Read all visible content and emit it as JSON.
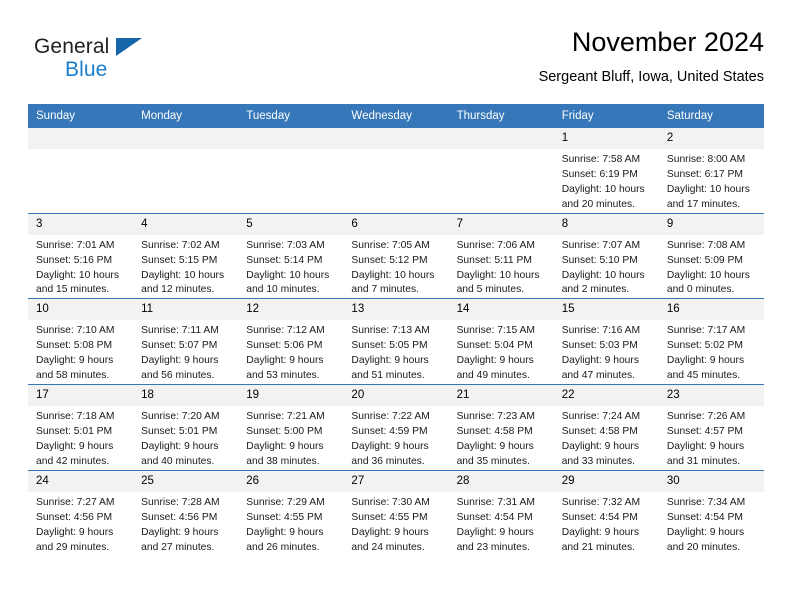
{
  "brand": {
    "name_part1": "General",
    "name_part2": "Blue"
  },
  "header": {
    "title": "November 2024",
    "location": "Sergeant Bluff, Iowa, United States"
  },
  "colors": {
    "header_blue": "#3577b8",
    "brand_blue": "#1b7fd0",
    "daynum_bg": "#f2f2f2"
  },
  "weekdays": [
    "Sunday",
    "Monday",
    "Tuesday",
    "Wednesday",
    "Thursday",
    "Friday",
    "Saturday"
  ],
  "weeks": [
    [
      {
        "day": "",
        "empty": true
      },
      {
        "day": "",
        "empty": true
      },
      {
        "day": "",
        "empty": true
      },
      {
        "day": "",
        "empty": true
      },
      {
        "day": "",
        "empty": true
      },
      {
        "day": "1",
        "sunrise": "Sunrise: 7:58 AM",
        "sunset": "Sunset: 6:19 PM",
        "daylight1": "Daylight: 10 hours",
        "daylight2": "and 20 minutes."
      },
      {
        "day": "2",
        "sunrise": "Sunrise: 8:00 AM",
        "sunset": "Sunset: 6:17 PM",
        "daylight1": "Daylight: 10 hours",
        "daylight2": "and 17 minutes."
      }
    ],
    [
      {
        "day": "3",
        "sunrise": "Sunrise: 7:01 AM",
        "sunset": "Sunset: 5:16 PM",
        "daylight1": "Daylight: 10 hours",
        "daylight2": "and 15 minutes."
      },
      {
        "day": "4",
        "sunrise": "Sunrise: 7:02 AM",
        "sunset": "Sunset: 5:15 PM",
        "daylight1": "Daylight: 10 hours",
        "daylight2": "and 12 minutes."
      },
      {
        "day": "5",
        "sunrise": "Sunrise: 7:03 AM",
        "sunset": "Sunset: 5:14 PM",
        "daylight1": "Daylight: 10 hours",
        "daylight2": "and 10 minutes."
      },
      {
        "day": "6",
        "sunrise": "Sunrise: 7:05 AM",
        "sunset": "Sunset: 5:12 PM",
        "daylight1": "Daylight: 10 hours",
        "daylight2": "and 7 minutes."
      },
      {
        "day": "7",
        "sunrise": "Sunrise: 7:06 AM",
        "sunset": "Sunset: 5:11 PM",
        "daylight1": "Daylight: 10 hours",
        "daylight2": "and 5 minutes."
      },
      {
        "day": "8",
        "sunrise": "Sunrise: 7:07 AM",
        "sunset": "Sunset: 5:10 PM",
        "daylight1": "Daylight: 10 hours",
        "daylight2": "and 2 minutes."
      },
      {
        "day": "9",
        "sunrise": "Sunrise: 7:08 AM",
        "sunset": "Sunset: 5:09 PM",
        "daylight1": "Daylight: 10 hours",
        "daylight2": "and 0 minutes."
      }
    ],
    [
      {
        "day": "10",
        "sunrise": "Sunrise: 7:10 AM",
        "sunset": "Sunset: 5:08 PM",
        "daylight1": "Daylight: 9 hours",
        "daylight2": "and 58 minutes."
      },
      {
        "day": "11",
        "sunrise": "Sunrise: 7:11 AM",
        "sunset": "Sunset: 5:07 PM",
        "daylight1": "Daylight: 9 hours",
        "daylight2": "and 56 minutes."
      },
      {
        "day": "12",
        "sunrise": "Sunrise: 7:12 AM",
        "sunset": "Sunset: 5:06 PM",
        "daylight1": "Daylight: 9 hours",
        "daylight2": "and 53 minutes."
      },
      {
        "day": "13",
        "sunrise": "Sunrise: 7:13 AM",
        "sunset": "Sunset: 5:05 PM",
        "daylight1": "Daylight: 9 hours",
        "daylight2": "and 51 minutes."
      },
      {
        "day": "14",
        "sunrise": "Sunrise: 7:15 AM",
        "sunset": "Sunset: 5:04 PM",
        "daylight1": "Daylight: 9 hours",
        "daylight2": "and 49 minutes."
      },
      {
        "day": "15",
        "sunrise": "Sunrise: 7:16 AM",
        "sunset": "Sunset: 5:03 PM",
        "daylight1": "Daylight: 9 hours",
        "daylight2": "and 47 minutes."
      },
      {
        "day": "16",
        "sunrise": "Sunrise: 7:17 AM",
        "sunset": "Sunset: 5:02 PM",
        "daylight1": "Daylight: 9 hours",
        "daylight2": "and 45 minutes."
      }
    ],
    [
      {
        "day": "17",
        "sunrise": "Sunrise: 7:18 AM",
        "sunset": "Sunset: 5:01 PM",
        "daylight1": "Daylight: 9 hours",
        "daylight2": "and 42 minutes."
      },
      {
        "day": "18",
        "sunrise": "Sunrise: 7:20 AM",
        "sunset": "Sunset: 5:01 PM",
        "daylight1": "Daylight: 9 hours",
        "daylight2": "and 40 minutes."
      },
      {
        "day": "19",
        "sunrise": "Sunrise: 7:21 AM",
        "sunset": "Sunset: 5:00 PM",
        "daylight1": "Daylight: 9 hours",
        "daylight2": "and 38 minutes."
      },
      {
        "day": "20",
        "sunrise": "Sunrise: 7:22 AM",
        "sunset": "Sunset: 4:59 PM",
        "daylight1": "Daylight: 9 hours",
        "daylight2": "and 36 minutes."
      },
      {
        "day": "21",
        "sunrise": "Sunrise: 7:23 AM",
        "sunset": "Sunset: 4:58 PM",
        "daylight1": "Daylight: 9 hours",
        "daylight2": "and 35 minutes."
      },
      {
        "day": "22",
        "sunrise": "Sunrise: 7:24 AM",
        "sunset": "Sunset: 4:58 PM",
        "daylight1": "Daylight: 9 hours",
        "daylight2": "and 33 minutes."
      },
      {
        "day": "23",
        "sunrise": "Sunrise: 7:26 AM",
        "sunset": "Sunset: 4:57 PM",
        "daylight1": "Daylight: 9 hours",
        "daylight2": "and 31 minutes."
      }
    ],
    [
      {
        "day": "24",
        "sunrise": "Sunrise: 7:27 AM",
        "sunset": "Sunset: 4:56 PM",
        "daylight1": "Daylight: 9 hours",
        "daylight2": "and 29 minutes."
      },
      {
        "day": "25",
        "sunrise": "Sunrise: 7:28 AM",
        "sunset": "Sunset: 4:56 PM",
        "daylight1": "Daylight: 9 hours",
        "daylight2": "and 27 minutes."
      },
      {
        "day": "26",
        "sunrise": "Sunrise: 7:29 AM",
        "sunset": "Sunset: 4:55 PM",
        "daylight1": "Daylight: 9 hours",
        "daylight2": "and 26 minutes."
      },
      {
        "day": "27",
        "sunrise": "Sunrise: 7:30 AM",
        "sunset": "Sunset: 4:55 PM",
        "daylight1": "Daylight: 9 hours",
        "daylight2": "and 24 minutes."
      },
      {
        "day": "28",
        "sunrise": "Sunrise: 7:31 AM",
        "sunset": "Sunset: 4:54 PM",
        "daylight1": "Daylight: 9 hours",
        "daylight2": "and 23 minutes."
      },
      {
        "day": "29",
        "sunrise": "Sunrise: 7:32 AM",
        "sunset": "Sunset: 4:54 PM",
        "daylight1": "Daylight: 9 hours",
        "daylight2": "and 21 minutes."
      },
      {
        "day": "30",
        "sunrise": "Sunrise: 7:34 AM",
        "sunset": "Sunset: 4:54 PM",
        "daylight1": "Daylight: 9 hours",
        "daylight2": "and 20 minutes."
      }
    ]
  ]
}
